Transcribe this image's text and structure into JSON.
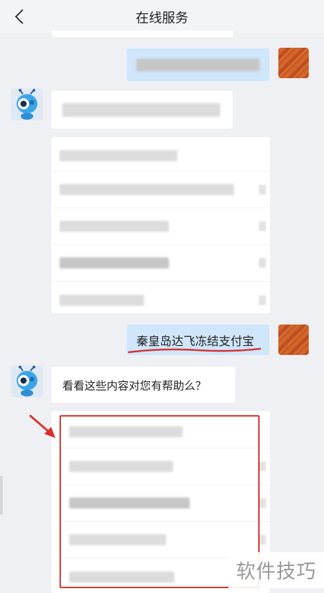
{
  "header": {
    "title": "在线服务"
  },
  "messages": {
    "user_query": "秦皇岛达飞冻结支付宝",
    "bot_prompt": "看看这些内容对您有帮助么？"
  },
  "watermark": "软件技巧",
  "colors": {
    "header_bg": "#f3f4f6",
    "page_bg": "#eef0f3",
    "user_bubble": "#cfe6fb",
    "bot_bubble": "#ffffff",
    "highlight": "#d9302c"
  },
  "icons": {
    "back": "chevron-left-icon",
    "bot_avatar": "ant-robot-icon",
    "user_avatar": "orange-wood-avatar"
  }
}
